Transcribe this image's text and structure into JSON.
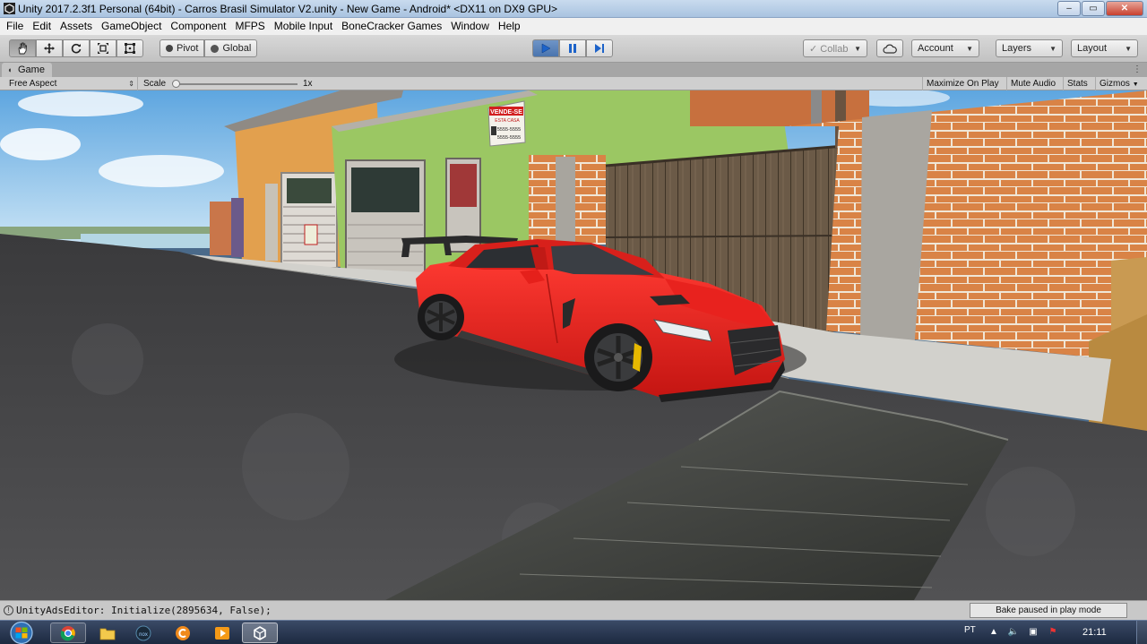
{
  "window": {
    "title": "Unity 2017.2.3f1 Personal (64bit) - Carros Brasil Simulator V2.unity - New Game - Android* <DX11 on DX9 GPU>",
    "controls": {
      "minimize": "–",
      "maximize": "▭",
      "close": "✕"
    }
  },
  "menu": {
    "items": [
      "File",
      "Edit",
      "Assets",
      "GameObject",
      "Component",
      "MFPS",
      "Mobile Input",
      "BoneCracker Games",
      "Window",
      "Help"
    ]
  },
  "toolbar": {
    "pivot_label": "Pivot",
    "global_label": "Global",
    "collab_label": "✓ Collab",
    "account_label": "Account",
    "layers_label": "Layers",
    "layout_label": "Layout",
    "play_state": "playing"
  },
  "game": {
    "tab_label": "Game",
    "aspect_label": "Free Aspect",
    "scale_label": "Scale",
    "scale_value": "1x",
    "maximize_label": "Maximize On Play",
    "mute_label": "Mute Audio",
    "stats_label": "Stats",
    "gizmos_label": "Gizmos",
    "sign_title": "VENDE-SE",
    "sign_subtitle": "ESTA CASA",
    "sign_phone1": "5555-5555",
    "sign_phone2": "5555-5555"
  },
  "status": {
    "message": "UnityAdsEditor: Initialize(2895634, False);",
    "bake_label": "Bake paused in play mode"
  },
  "taskbar": {
    "language": "PT",
    "time": "21:11",
    "apps": [
      "chrome-icon",
      "file-explorer-icon",
      "nox-icon",
      "c-app-icon",
      "media-player-icon",
      "unity-icon"
    ]
  },
  "colors": {
    "car": "#e8211e",
    "toolbar": "#c8c8c8",
    "play_accent": "#4a74ae"
  }
}
